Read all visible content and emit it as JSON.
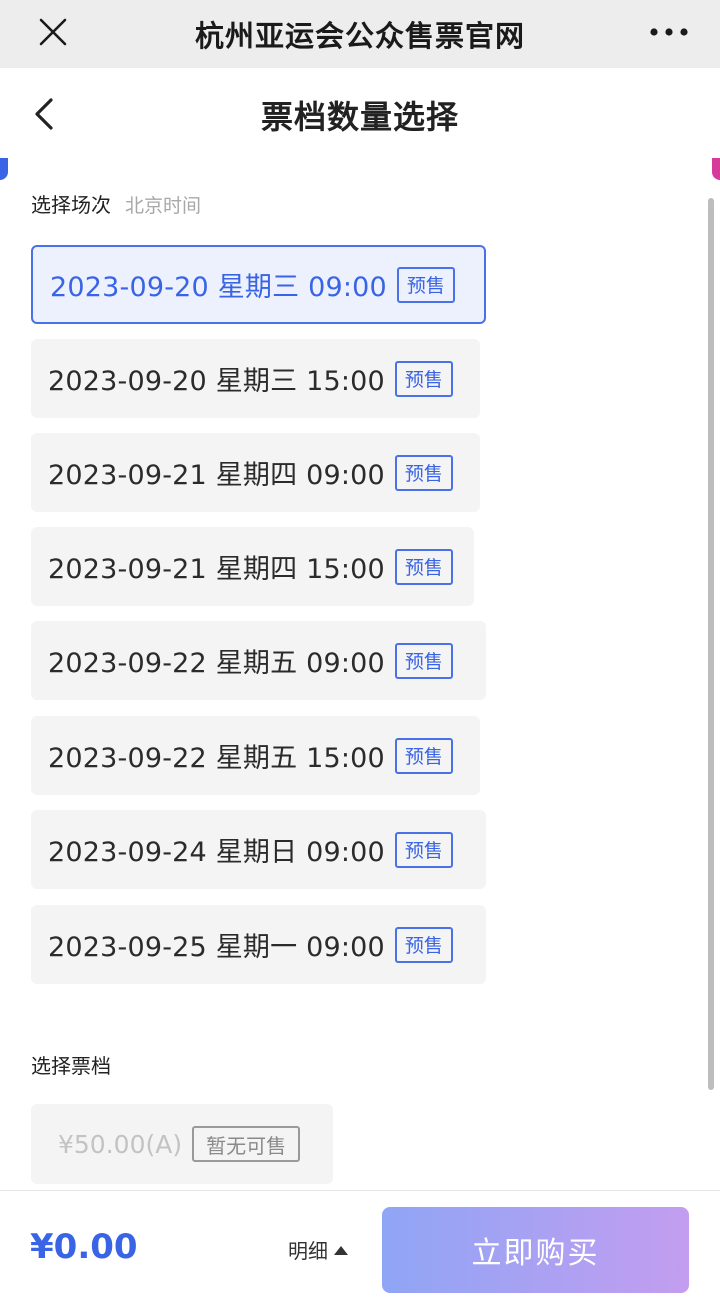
{
  "topbar": {
    "title": "杭州亚运会公众售票官网"
  },
  "page": {
    "title": "票档数量选择"
  },
  "sessions_section": {
    "label": "选择场次",
    "sublabel": "北京时间"
  },
  "sessions": [
    {
      "text": "2023-09-20 星期三 09:00",
      "badge": "预售",
      "selected": true
    },
    {
      "text": "2023-09-20 星期三 15:00",
      "badge": "预售",
      "selected": false
    },
    {
      "text": "2023-09-21 星期四 09:00",
      "badge": "预售",
      "selected": false
    },
    {
      "text": "2023-09-21 星期四 15:00",
      "badge": "预售",
      "selected": false
    },
    {
      "text": "2023-09-22 星期五 09:00",
      "badge": "预售",
      "selected": false
    },
    {
      "text": "2023-09-22 星期五 15:00",
      "badge": "预售",
      "selected": false
    },
    {
      "text": "2023-09-24 星期日 09:00",
      "badge": "预售",
      "selected": false
    },
    {
      "text": "2023-09-25 星期一 09:00",
      "badge": "预售",
      "selected": false
    }
  ],
  "tickets_section": {
    "label": "选择票档"
  },
  "tickets": [
    {
      "price": "¥50.00(A)",
      "status": "暂无可售"
    }
  ],
  "footer": {
    "total": "¥0.00",
    "detail_label": "明细",
    "buy_label": "立即购买"
  },
  "colors": {
    "accent": "#3a64e6",
    "selected_bg": "#ecf1fd",
    "buy_gradient_start": "#8fa5f5",
    "buy_gradient_end": "#c39df0",
    "corner_right": "#d63a9a"
  },
  "icons": {
    "close": "close-icon",
    "more": "more-dots-icon",
    "back": "chevron-left-icon",
    "detail_toggle": "triangle-up-icon"
  }
}
